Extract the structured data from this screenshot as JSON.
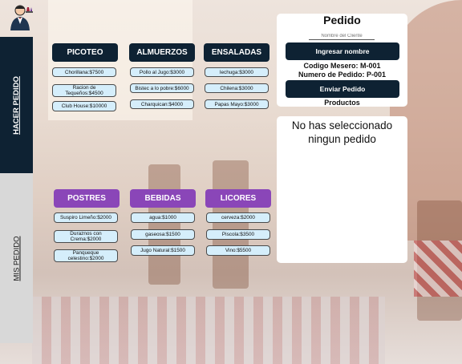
{
  "sidebar": {
    "tabs": [
      {
        "label": "HACER PEDIDO"
      },
      {
        "label": "MIS PEDIDO"
      }
    ]
  },
  "menu": {
    "categories": [
      {
        "label": "PICOTEO",
        "items": [
          "Chorillana:$7500",
          "Racion de Tequeños:$4500",
          "Club House:$10000"
        ]
      },
      {
        "label": "ALMUERZOS",
        "items": [
          "Pollo al Jugo:$3000",
          "Bistec a lo pobre:$6000",
          "Charquican:$4000"
        ]
      },
      {
        "label": "ENSALADAS",
        "items": [
          "lechuga:$3000",
          "Chilena:$3000",
          "Papas Mayo:$3000"
        ]
      },
      {
        "label": "POSTRES",
        "items": [
          "Suspiro Limeño:$2000",
          "Duraznos con Crema:$2000",
          "Panqueque celestino:$2000"
        ]
      },
      {
        "label": "BEBIDAS",
        "items": [
          "agua:$1000",
          "gaseosa:$1500",
          "Jugo Natural:$1500"
        ]
      },
      {
        "label": "LICORES",
        "items": [
          "cerveza:$2000",
          "Piscola:$3500",
          "Vino:$5500"
        ]
      }
    ]
  },
  "order": {
    "title": "Pedido",
    "name_placeholder": "Nombre del Cliente",
    "set_name_label": "Ingresar nombre",
    "waiter_code": "Codigo Mesero: M-001",
    "order_number": "Numero de Pedido: P-001",
    "send_label": "Enviar Pedido",
    "products_label": "Productos",
    "empty_message": "No has seleccionado ningun pedido"
  },
  "colors": {
    "dark": "#0e2233",
    "purple": "#8a46b8",
    "item_bg": "#d5eefb"
  }
}
